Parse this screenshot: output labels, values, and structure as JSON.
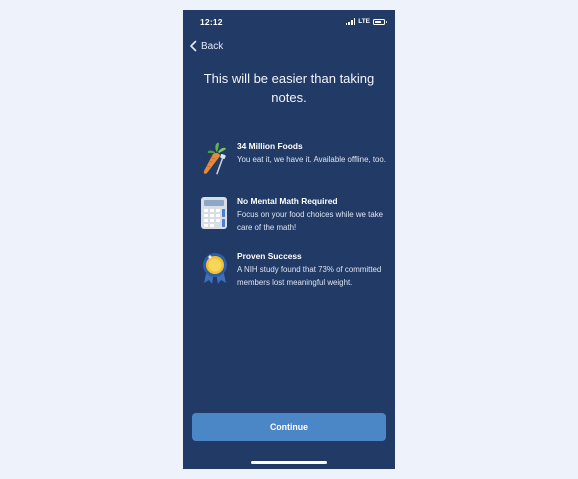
{
  "status_bar": {
    "time": "12:12",
    "network": "LTE"
  },
  "nav": {
    "back_label": "Back"
  },
  "headline": "This will be easier than taking notes.",
  "features": [
    {
      "icon": "carrot-icon",
      "title": "34 Million Foods",
      "description": "You eat it, we have it. Available offline, too."
    },
    {
      "icon": "calculator-icon",
      "title": "No Mental Math Required",
      "description": "Focus on your food choices while we take care of the math!"
    },
    {
      "icon": "medal-icon",
      "title": "Proven Success",
      "description": "A NIH study found that 73% of committed members lost meaningful weight."
    }
  ],
  "continue_label": "Continue",
  "colors": {
    "background": "#223a66",
    "button": "#4b86c7",
    "page": "#eef3fb"
  }
}
